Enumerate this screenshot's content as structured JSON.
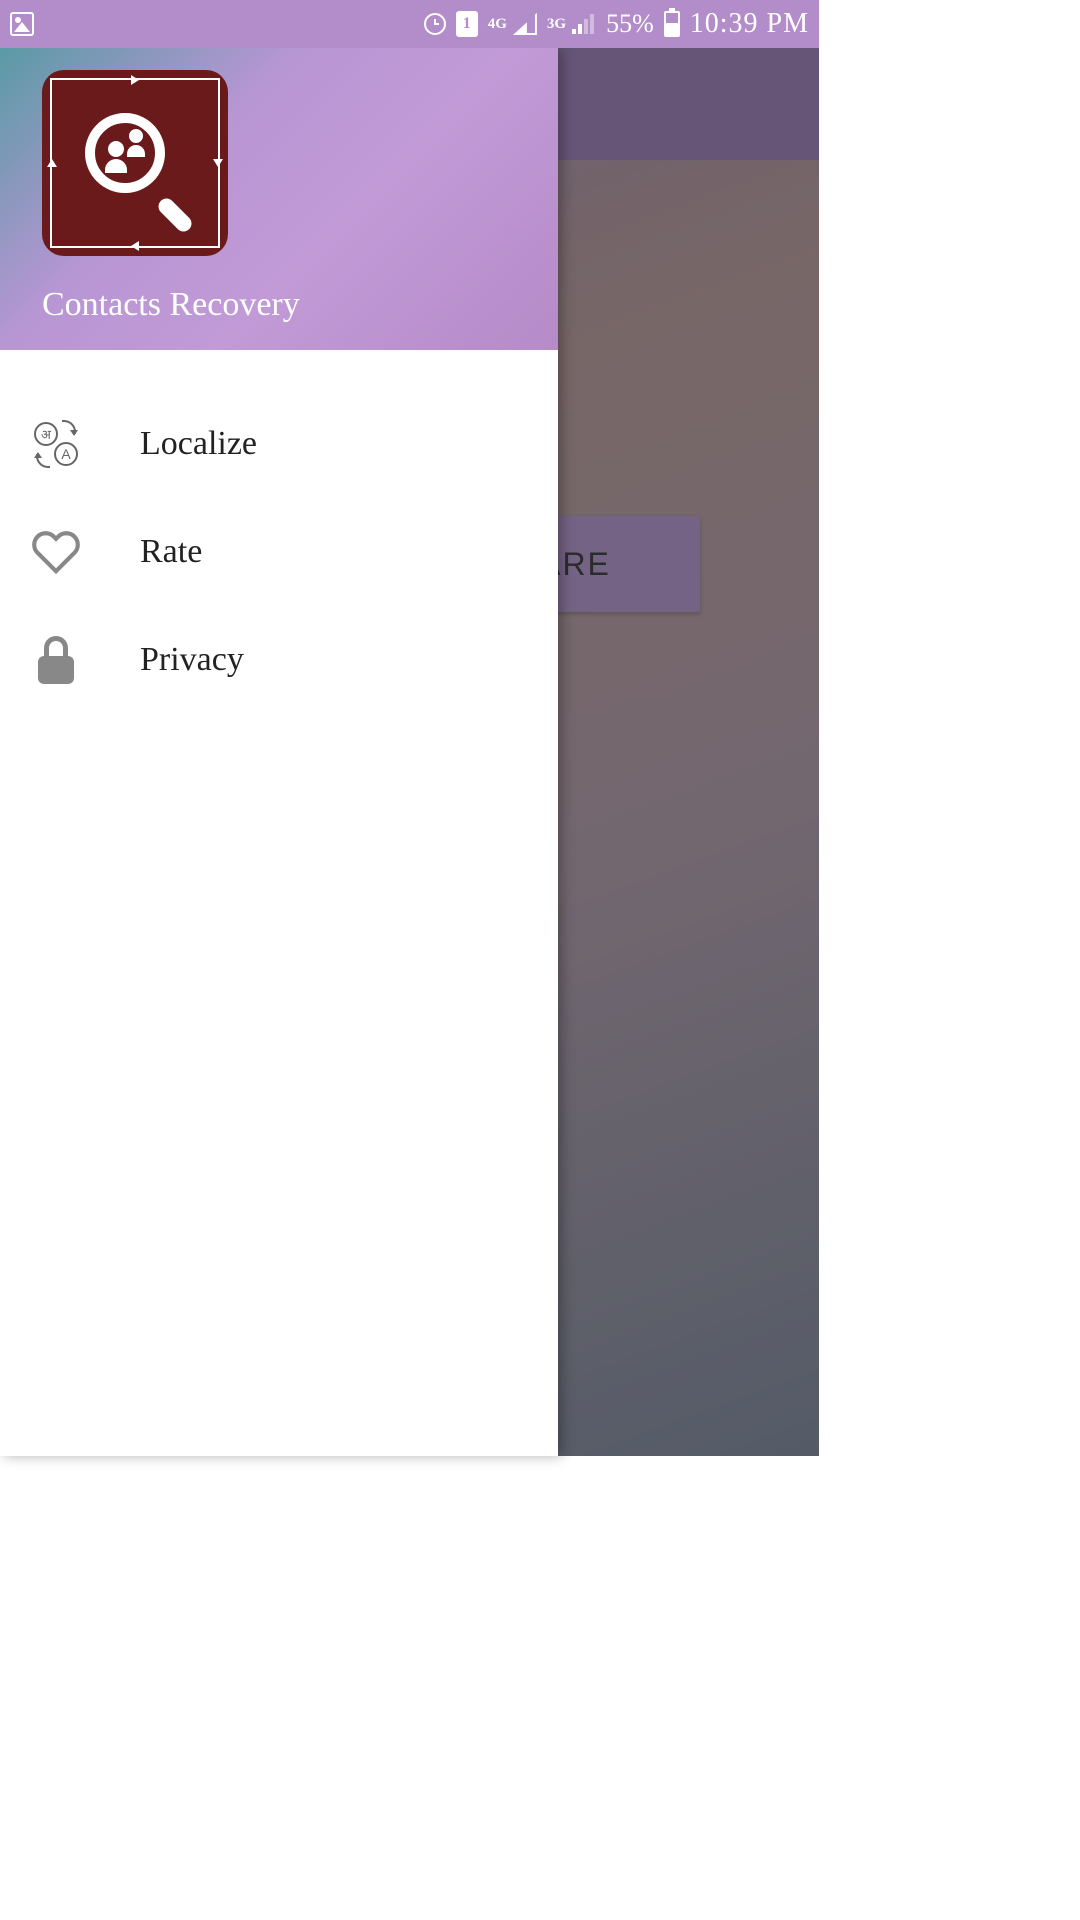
{
  "statusbar": {
    "sim_number": "1",
    "network1": "4G",
    "network2": "3G",
    "battery_percent": "55%",
    "time": "10:39 PM"
  },
  "drawer": {
    "app_title": "Contacts Recovery",
    "menu": {
      "localize": "Localize",
      "rate": "Rate",
      "privacy": "Privacy"
    }
  },
  "main": {
    "share_button": "ARE"
  }
}
